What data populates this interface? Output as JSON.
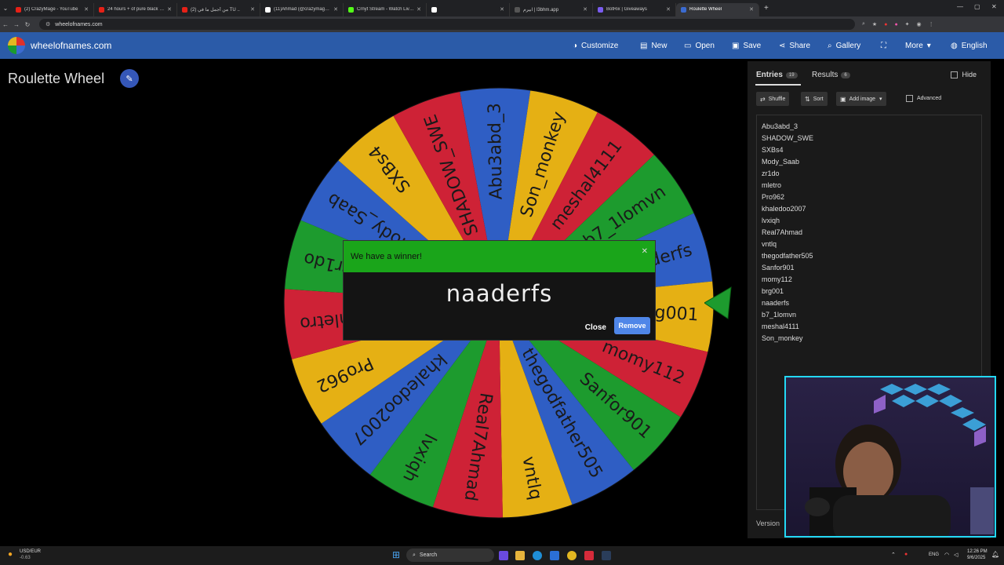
{
  "browser": {
    "tabs": [
      {
        "label": "(2) CrazyMage - YouTube",
        "color": "#e62117"
      },
      {
        "label": "24 hours + of pure black screen",
        "color": "#e62117"
      },
      {
        "label": "(2) من أجمل ما في TU ..",
        "color": "#e62117"
      },
      {
        "label": "(11)Ahmad (@crazymageyt) | TikTok",
        "color": "#ffffff"
      },
      {
        "label": "Crnyt Stream - Watch Live on Kick",
        "color": "#53fc18"
      },
      {
        "label": "",
        "color": "#ffffff"
      },
      {
        "label": "ابيرم | l3bhm.app",
        "color": "#555555"
      },
      {
        "label": "BotRix | Giveaways",
        "color": "#7a5cf0"
      },
      {
        "label": "Roulette Wheel",
        "color": "#3b6bd1"
      }
    ],
    "url": "wheelofnames.com"
  },
  "header": {
    "site_name": "wheelofnames.com",
    "menu": [
      {
        "label": "Customize",
        "icon": "palette-icon"
      },
      {
        "label": "New",
        "icon": "file-icon"
      },
      {
        "label": "Open",
        "icon": "folder-icon"
      },
      {
        "label": "Save",
        "icon": "save-icon"
      },
      {
        "label": "Share",
        "icon": "share-icon"
      },
      {
        "label": "Gallery",
        "icon": "search-icon"
      },
      {
        "label": "",
        "icon": "fullscreen-icon"
      },
      {
        "label": "More",
        "icon": "chevron-down-icon"
      },
      {
        "label": "English",
        "icon": "globe-icon"
      }
    ]
  },
  "page": {
    "title": "Roulette Wheel"
  },
  "wheel": {
    "colors": [
      "#2f5ec4",
      "#e5b014",
      "#ce2236",
      "#1d9b2e"
    ],
    "labels": [
      "Abu3abd_3",
      "Son_monkey",
      "meshal4111",
      "b7_1lomvn",
      "naaderfs",
      "brg001",
      "momy112",
      "Sanfor901",
      "thegodfather505",
      "vntlq",
      "Real7Ahmad",
      "lvxiqh",
      "khaledoo2007",
      "Pro962",
      "mletro",
      "zr1do",
      "Mody_Saab",
      "SXBs4",
      "SHADOW_SWE"
    ]
  },
  "modal": {
    "title": "We have a winner!",
    "winner": "naaderfs",
    "close_label": "Close",
    "remove_label": "Remove"
  },
  "panel": {
    "entries_tab": "Entries",
    "entries_count": "19",
    "results_tab": "Results",
    "results_count": "6",
    "hide_label": "Hide",
    "shuffle_label": "Shuffle",
    "sort_label": "Sort",
    "add_image_label": "Add image",
    "advanced_label": "Advanced",
    "entries": [
      "Abu3abd_3",
      "SHADOW_SWE",
      "SXBs4",
      "Mody_Saab",
      "zr1do",
      "mletro",
      "Pro962",
      "khaledoo2007",
      "lvxiqh",
      "Real7Ahmad",
      "vntlq",
      "thegodfather505",
      "Sanfor901",
      "momy112",
      "brg001",
      "naaderfs",
      "b7_1lomvn",
      "meshal4111",
      "Son_monkey"
    ],
    "version_label": "Version"
  },
  "taskbar": {
    "ticker": "USD/EUR",
    "ticker_value": "-0.63",
    "search_label": "Search",
    "lang": "ENG",
    "time": "12:26 PM",
    "date": "9/6/2025"
  }
}
